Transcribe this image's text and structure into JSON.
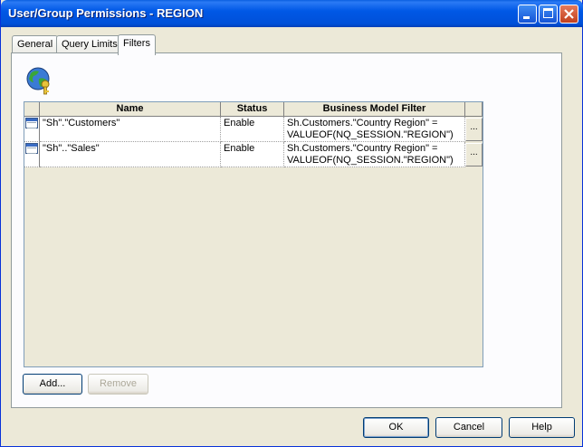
{
  "window": {
    "title": "User/Group Permissions - REGION"
  },
  "tabs": [
    {
      "label": "General",
      "active": false
    },
    {
      "label": "Query Limits",
      "active": false
    },
    {
      "label": "Filters",
      "active": true
    }
  ],
  "filters_icon": "globe-key-icon",
  "grid": {
    "columns": [
      "Name",
      "Status",
      "Business Model Filter"
    ],
    "rows": [
      {
        "name": "\"Sh\".\"Customers\"",
        "status": "Enable",
        "filter_line1": "Sh.Customers.\"Country Region\" =",
        "filter_line2": "VALUEOF(NQ_SESSION.\"REGION\")",
        "more": "..."
      },
      {
        "name": "\"Sh\"..\"Sales\"",
        "status": "Enable",
        "filter_line1": "Sh.Customers.\"Country Region\" =",
        "filter_line2": "VALUEOF(NQ_SESSION.\"REGION\")",
        "more": "..."
      }
    ]
  },
  "buttons": {
    "add": "Add...",
    "remove": "Remove",
    "ok": "OK",
    "cancel": "Cancel",
    "help": "Help"
  },
  "colors": {
    "titlebar": "#0058e6",
    "face": "#ece9d8",
    "panel": "#fcfcfe"
  }
}
